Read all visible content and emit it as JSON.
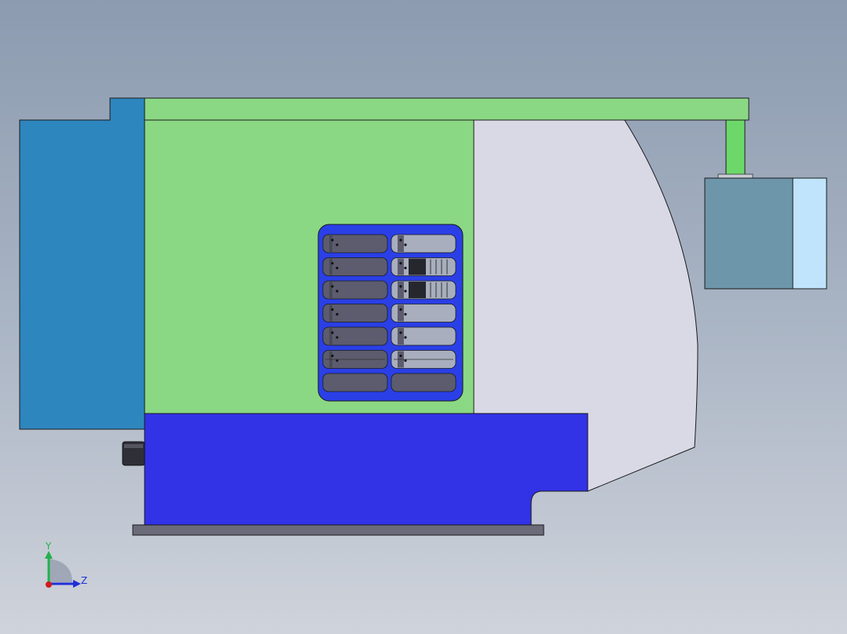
{
  "triad": {
    "y_label": "Y",
    "z_label": "Z",
    "y_color": "#22b14c",
    "z_color": "#1f2fd6",
    "x_color": "#d11b1b"
  },
  "colors": {
    "background_top": "#8c9bb0",
    "background_bottom": "#cfd3db",
    "side_panel": "#2e86be",
    "top_plate": "#8bd884",
    "main_body": "#8bd884",
    "housing": "#d9d9e6",
    "base_block": "#3232e6",
    "base_plate": "#6b6b7a",
    "tool_rack": "#2a3fe6",
    "slot_dark": "#5c5c6e",
    "slot_light": "#a8aebd",
    "motor_body": "#6e96aa",
    "motor_cap": "#bfe4fb",
    "motor_shaft": "#6dd86a"
  },
  "tool_rack": {
    "rows": 7,
    "columns": 2
  }
}
